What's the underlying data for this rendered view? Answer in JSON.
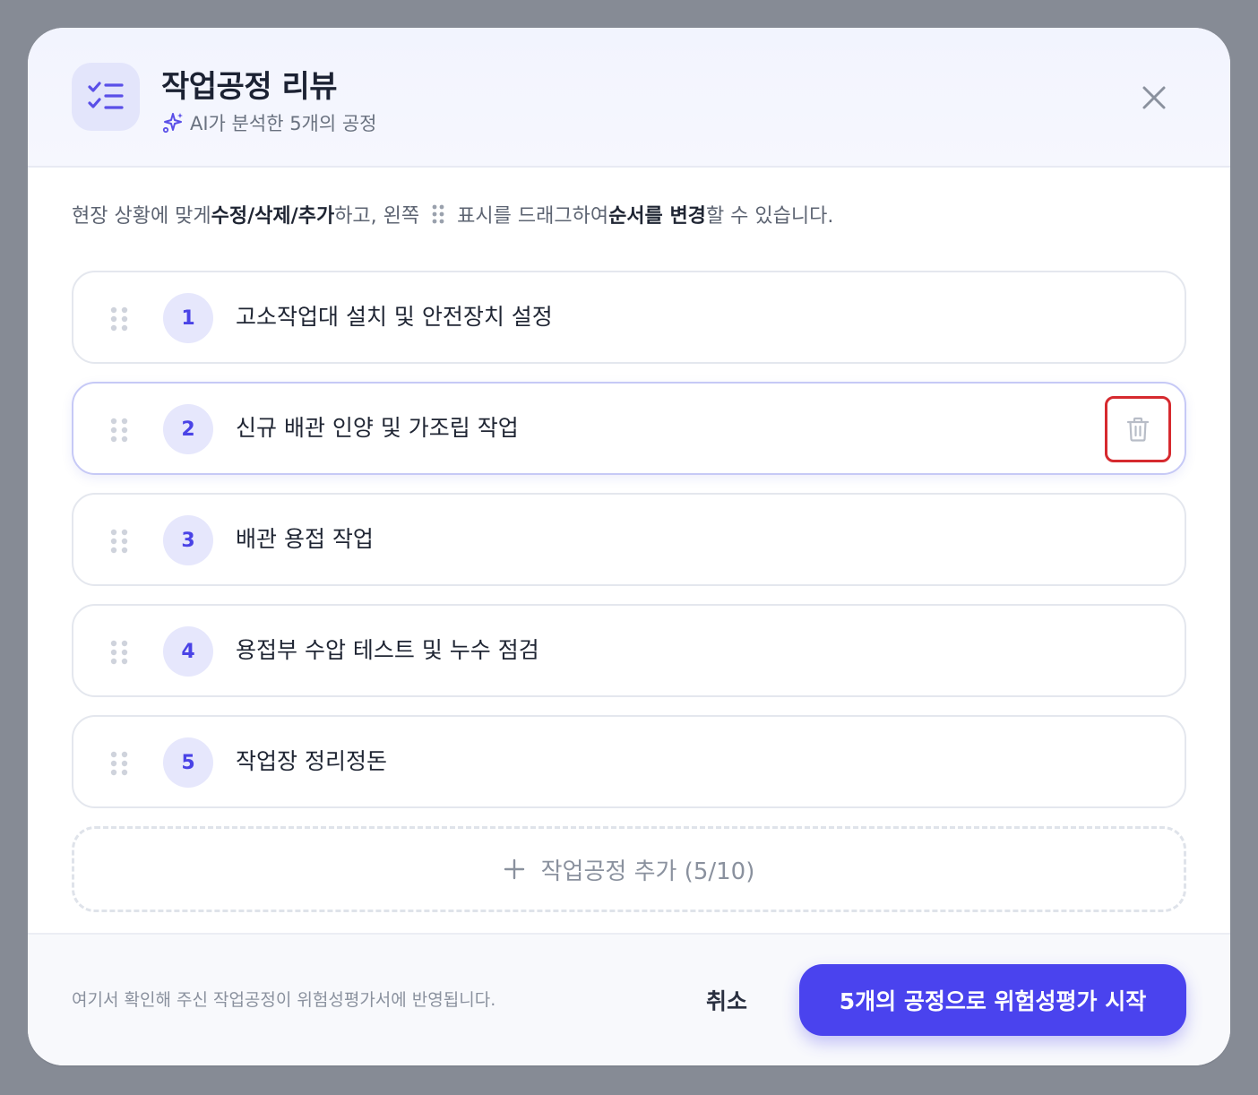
{
  "header": {
    "title": "작업공정 리뷰",
    "subtitle": "AI가 분석한 5개의 공정",
    "icon": "checklist-icon",
    "subtitle_icon": "sparkle-icon",
    "close_icon": "close-icon"
  },
  "instructions": {
    "part1": "현장 상황에 맞게 ",
    "bold1": "수정/삭제/추가",
    "part2": "하고, 왼쪽",
    "part3": "표시를 드래그하여 ",
    "bold2": "순서를 변경",
    "part4": "할 수 있습니다."
  },
  "steps": [
    {
      "number": "1",
      "label": "고소작업대 설치 및 안전장치 설정"
    },
    {
      "number": "2",
      "label": "신규 배관 인양 및 가조립 작업"
    },
    {
      "number": "3",
      "label": "배관 용접 작업"
    },
    {
      "number": "4",
      "label": "용접부 수압 테스트 및 누수 점검"
    },
    {
      "number": "5",
      "label": "작업장 정리정돈"
    }
  ],
  "add_step": {
    "label": "작업공정 추가 (5/10)",
    "icon": "plus-icon"
  },
  "footer": {
    "note": "여기서 확인해 주신 작업공정이 위험성평가서에 반영됩니다.",
    "cancel_label": "취소",
    "primary_label": "5개의 공정으로 위험성평가 시작"
  },
  "colors": {
    "accent": "#4a43ee",
    "delete_highlight": "#d62a2f",
    "badge_bg": "#e6e7fc"
  }
}
